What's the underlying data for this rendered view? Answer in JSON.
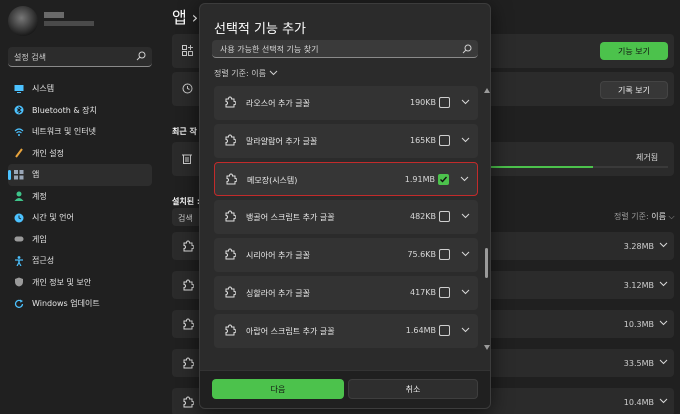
{
  "sidebar": {
    "search_placeholder": "설정 검색",
    "items": [
      {
        "label": "시스템",
        "icon": "monitor-icon",
        "color": "#4cc2ff"
      },
      {
        "label": "Bluetooth & 장치",
        "icon": "bluetooth-icon",
        "color": "#4cc2ff"
      },
      {
        "label": "네트워크 및 인터넷",
        "icon": "wifi-icon",
        "color": "#4cc2ff"
      },
      {
        "label": "개인 설정",
        "icon": "brush-icon",
        "color": "#e8a33c"
      },
      {
        "label": "앱",
        "icon": "apps-icon",
        "color": "#9aa7b8",
        "active": true
      },
      {
        "label": "계정",
        "icon": "person-icon",
        "color": "#3ec48a"
      },
      {
        "label": "시간 및 언어",
        "icon": "globe-clock-icon",
        "color": "#4cc2ff"
      },
      {
        "label": "게임",
        "icon": "gamepad-icon",
        "color": "#9a9a9a"
      },
      {
        "label": "접근성",
        "icon": "accessibility-icon",
        "color": "#4cc2ff"
      },
      {
        "label": "개인 정보 및 보안",
        "icon": "shield-icon",
        "color": "#9a9a9a"
      },
      {
        "label": "Windows 업데이트",
        "icon": "update-icon",
        "color": "#4cc2ff"
      }
    ]
  },
  "main": {
    "title": "앱 ›",
    "view_features_label": "기능 보기",
    "history_label": "기록 보기",
    "recent_label": "최근 작",
    "remove_label": "제거됨",
    "remove_progress": 0.6,
    "installed_label": "설치된 :",
    "search_label": "검색",
    "sort_prefix": "정렬 기준:",
    "sort_value": "이름",
    "installed_sizes": [
      "3.28MB",
      "3.12MB",
      "10.3MB",
      "33.5MB",
      "10.4MB"
    ]
  },
  "dialog": {
    "title": "선택적 기능 추가",
    "search_placeholder": "사용 가능한 선택적 기능 찾기",
    "sort_label": "정렬 기준: 이름",
    "features": [
      {
        "name": "라오스어 추가 글꼴",
        "size": "190KB",
        "checked": false
      },
      {
        "name": "말라얄람어 추가 글꼴",
        "size": "165KB",
        "checked": false
      },
      {
        "name": "메모장(시스템)",
        "size": "1.91MB",
        "checked": true
      },
      {
        "name": "뱅골어 스크립트 추가 글꼴",
        "size": "482KB",
        "checked": false
      },
      {
        "name": "시리아어 추가 글꼴",
        "size": "75.6KB",
        "checked": false
      },
      {
        "name": "싱할라어 추가 글꼴",
        "size": "417KB",
        "checked": false
      },
      {
        "name": "아랍어 스크립트 추가 글꼴",
        "size": "1.64MB",
        "checked": false
      }
    ],
    "next_label": "다음",
    "cancel_label": "취소"
  },
  "colors": {
    "accent": "#4cc24c",
    "selection_border": "#c22b2b",
    "nav_accent": "#4cc2ff"
  }
}
